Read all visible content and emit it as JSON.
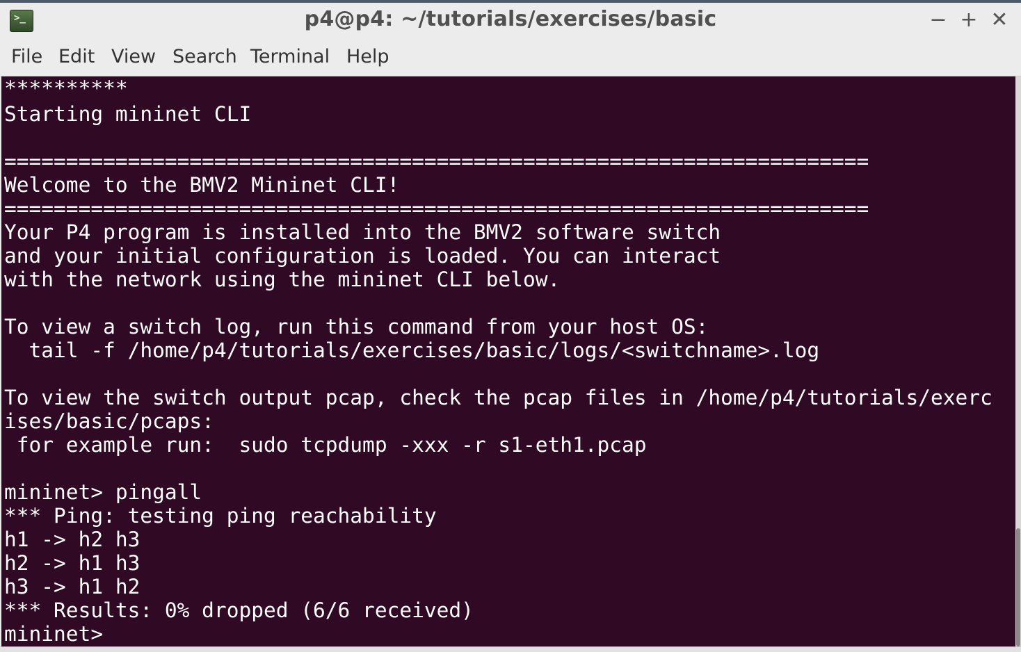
{
  "window": {
    "title": "p4@p4: ~/tutorials/exercises/basic",
    "minimize_glyph": "−",
    "maximize_glyph": "+",
    "close_glyph": "✕",
    "icon_glyph": ">_"
  },
  "menu": {
    "items": [
      "File",
      "Edit",
      "View",
      "Search",
      "Terminal",
      "Help"
    ]
  },
  "colors": {
    "terminal_bg": "#300a24",
    "terminal_fg": "#ffffff",
    "chrome_bg": "#ececec"
  },
  "terminal": {
    "lines": [
      "**********",
      "Starting mininet CLI",
      "",
      "======================================================================",
      "Welcome to the BMV2 Mininet CLI!",
      "======================================================================",
      "Your P4 program is installed into the BMV2 software switch",
      "and your initial configuration is loaded. You can interact",
      "with the network using the mininet CLI below.",
      "",
      "To view a switch log, run this command from your host OS:",
      "  tail -f /home/p4/tutorials/exercises/basic/logs/<switchname>.log",
      "",
      "To view the switch output pcap, check the pcap files in /home/p4/tutorials/exerc",
      "ises/basic/pcaps:",
      " for example run:  sudo tcpdump -xxx -r s1-eth1.pcap",
      "",
      "mininet> pingall",
      "*** Ping: testing ping reachability",
      "h1 -> h2 h3",
      "h2 -> h1 h3",
      "h3 -> h1 h2",
      "*** Results: 0% dropped (6/6 received)",
      "mininet> "
    ]
  }
}
